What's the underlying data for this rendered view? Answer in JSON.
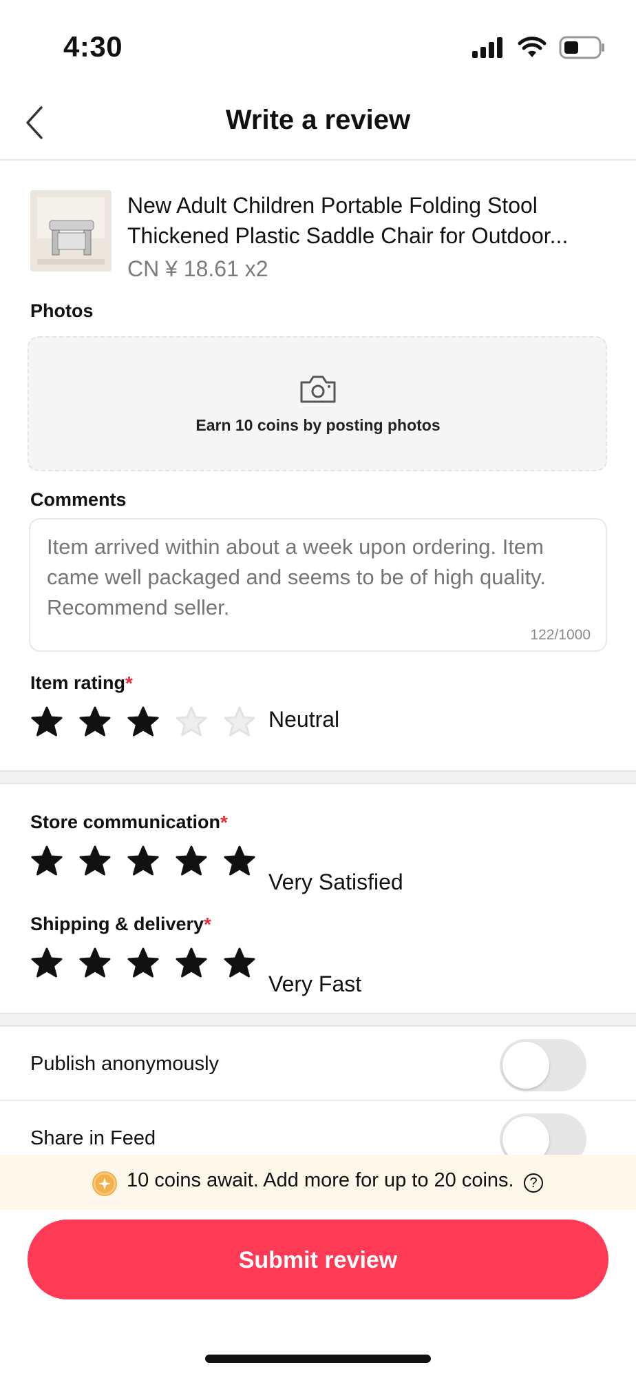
{
  "status_bar": {
    "time": "4:30"
  },
  "header": {
    "title": "Write a review"
  },
  "product": {
    "name": "New Adult Children Portable Folding Stool Thickened Plastic Saddle Chair for Outdoor...",
    "price": "CN ¥ 18.61 x2"
  },
  "photos": {
    "label": "Photos",
    "prompt": "Earn 10 coins by posting photos"
  },
  "comments": {
    "label": "Comments",
    "value": "Item arrived within about a week upon ordering. Item came well packaged and seems to be of high quality. Recommend seller.",
    "counter": "122/1000"
  },
  "ratings": {
    "item": {
      "label": "Item rating",
      "required": "*",
      "value": 3,
      "max": 5,
      "text": "Neutral"
    },
    "store": {
      "label": "Store communication",
      "required": "*",
      "value": 5,
      "max": 5,
      "text": "Very Satisfied"
    },
    "shipping": {
      "label": "Shipping & delivery",
      "required": "*",
      "value": 5,
      "max": 5,
      "text": "Very Fast"
    }
  },
  "options": {
    "anonymous": {
      "label": "Publish anonymously",
      "on": false
    },
    "share": {
      "label": "Share in Feed",
      "on": false
    }
  },
  "banner": {
    "text": "10 coins await. Add more for up to 20 coins.",
    "help": "?"
  },
  "submit": {
    "label": "Submit review"
  },
  "colors": {
    "accent": "#fe3a55",
    "star_filled": "#111111",
    "star_empty": "#eeeeee"
  }
}
